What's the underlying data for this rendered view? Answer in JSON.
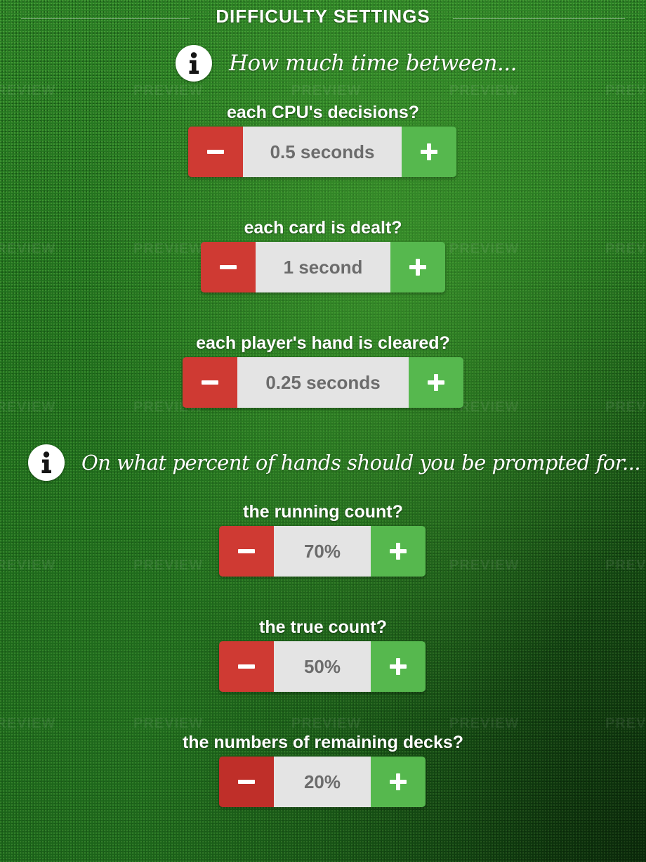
{
  "header": {
    "title": "DIFFICULTY SETTINGS"
  },
  "watermark": "PREVIEW",
  "sections": [
    {
      "icon": "info-icon",
      "prompt": "How much time between...",
      "settings": [
        {
          "label": "each CPU's decisions?",
          "value": "0.5 seconds"
        },
        {
          "label": "each card is dealt?",
          "value": "1 second"
        },
        {
          "label": "each player's hand is cleared?",
          "value": "0.25 seconds"
        }
      ]
    },
    {
      "icon": "info-icon",
      "prompt": "On what percent of hands should you be prompted for...",
      "settings": [
        {
          "label": "the running count?",
          "value": "70%"
        },
        {
          "label": "the true count?",
          "value": "50%"
        },
        {
          "label": "the numbers of remaining decks?",
          "value": "20%"
        }
      ]
    }
  ],
  "controls": {
    "decrement_icon": "minus-icon",
    "increment_icon": "plus-icon"
  },
  "colors": {
    "background": "#1f6b1c",
    "decrement": "#cf3a33",
    "increment": "#56b84e",
    "value_field": "#e4e4e4",
    "value_text": "#6c6c6c",
    "text": "#ffffff"
  }
}
